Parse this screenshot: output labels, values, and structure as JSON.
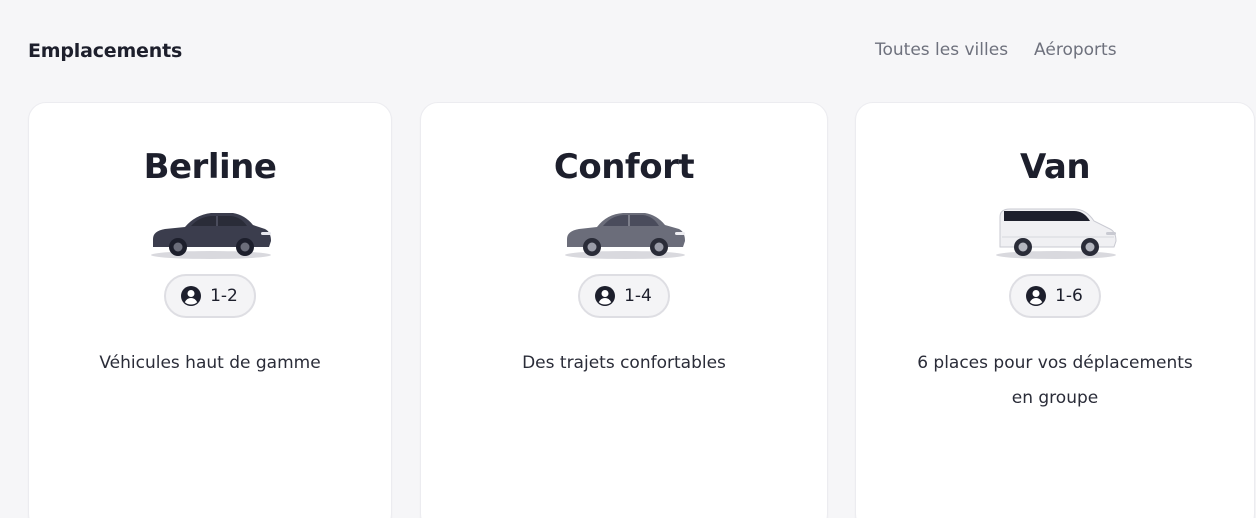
{
  "header": {
    "title": "Emplacements",
    "links": [
      "Toutes les villes",
      "Aéroports"
    ]
  },
  "cards": [
    {
      "title": "Berline",
      "vehicle_icon": "sedan-car-icon",
      "vehicle_color": "#3b3d4d",
      "capacity": "1-2",
      "description": "Véhicules haut de gamme"
    },
    {
      "title": "Confort",
      "vehicle_icon": "comfort-car-icon",
      "vehicle_color": "#6b6d7a",
      "capacity": "1-4",
      "description": "Des trajets confortables"
    },
    {
      "title": "Van",
      "vehicle_icon": "van-icon",
      "vehicle_color": "#f0f0f3",
      "capacity": "1-6",
      "description": "6 places pour vos déplacements en groupe"
    }
  ],
  "colors": {
    "background": "#f6f6f8",
    "card": "#ffffff",
    "text": "#1d1f2c",
    "muted": "#6e717d",
    "pill_border": "#dedee3"
  }
}
